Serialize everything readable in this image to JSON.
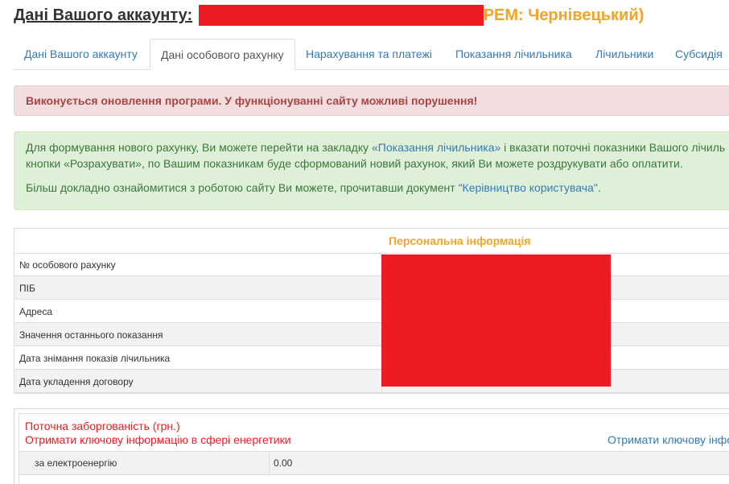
{
  "header": {
    "title": "Дані Вашого аккаунту:",
    "rem": "РЕМ: Чернівецький)"
  },
  "tabs": [
    {
      "label": "Дані Вашого аккаунту",
      "active": false
    },
    {
      "label": "Дані особового рахунку",
      "active": true
    },
    {
      "label": "Нарахування та платежі",
      "active": false
    },
    {
      "label": "Показання лічильника",
      "active": false
    },
    {
      "label": "Лічильники",
      "active": false
    },
    {
      "label": "Субсидія",
      "active": false
    }
  ],
  "alerts": {
    "update_warning": "Виконується оновлення програми. У функціонуванні сайту можливі порушення!",
    "info": {
      "line1_prefix": "Для формування нового рахунку, Ви можете перейти на закладку ",
      "line1_link": "«Показання лічильника»",
      "line1_suffix": " і вказати поточні показники Вашого лічиль",
      "line2": "кнопки «Розрахувати», по Вашим показникам буде сформований новий рахунок, який Ви можете роздрукувати або оплатити.",
      "line3_prefix": "Більш докладно ознайомитися з роботою сайту Ви можете, прочитавши документ ",
      "line3_link": "\"Керівництво користувача\"",
      "line3_suffix": "."
    }
  },
  "personal_info": {
    "header": "Персональна інформація",
    "rows": [
      {
        "label": "№ особового рахунку"
      },
      {
        "label": "ПІБ"
      },
      {
        "label": "Адреса"
      },
      {
        "label": "Значення останнього показання"
      },
      {
        "label": "Дата знімання показів лічильника"
      },
      {
        "label": "Дата укладення договору"
      }
    ]
  },
  "debt": {
    "title": "Поточна заборгованість (грн.)",
    "key_info_red": "Отримати ключову інформацію в сфері енергетики",
    "key_info_blue": "Отримати ключову інфо",
    "row_label": "за електроенергію",
    "row_value": "0.00"
  },
  "colors": {
    "accent_orange": "#f0a52a",
    "link_blue": "#337ab7",
    "danger_red": "#ed1c24",
    "redaction": "#ed1c24"
  }
}
